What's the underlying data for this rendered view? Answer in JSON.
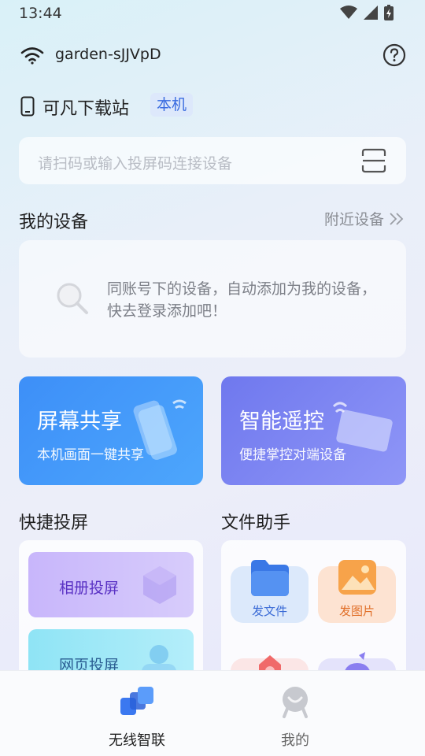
{
  "status_bar": {
    "time": "13:44"
  },
  "wifi": {
    "ssid": "garden-sJJVpD"
  },
  "device": {
    "name": "可凡下载站",
    "badge": "本机"
  },
  "search": {
    "placeholder": "请扫码或输入投屏码连接设备"
  },
  "my_devices": {
    "title": "我的设备",
    "nearby_label": "附近设备",
    "empty_message": "同账号下的设备，自动添加为我的设备，快去登录添加吧！"
  },
  "feature_cards": [
    {
      "title": "屏幕共享",
      "subtitle": "本机画面一键共享",
      "color": "#3d8ff8"
    },
    {
      "title": "智能遥控",
      "subtitle": "便捷掌控对端设备",
      "color": "#6f78ee"
    }
  ],
  "quick_cast": {
    "title": "快捷投屏",
    "items": [
      {
        "label": "相册投屏"
      },
      {
        "label": "网页投屏"
      }
    ]
  },
  "file_helper": {
    "title": "文件助手",
    "items": [
      {
        "label": "发文件"
      },
      {
        "label": "发图片"
      }
    ]
  },
  "bottom_nav": [
    {
      "label": "无线智联",
      "active": true
    },
    {
      "label": "我的",
      "active": false
    }
  ]
}
